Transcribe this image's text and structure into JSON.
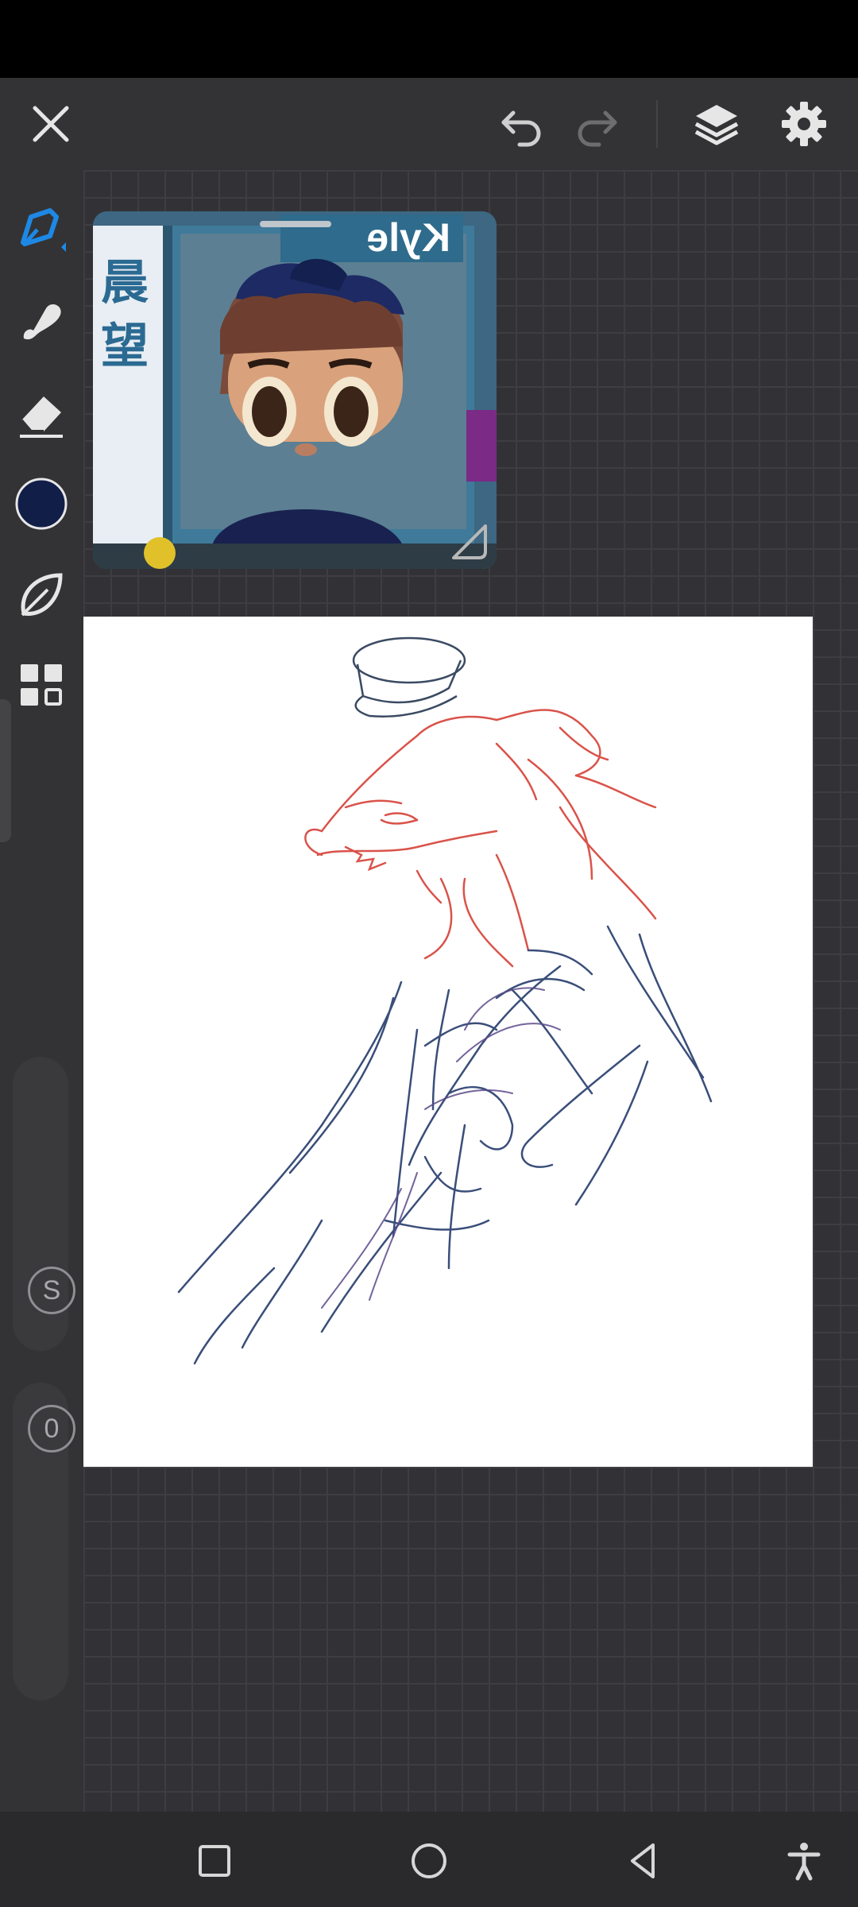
{
  "app": {
    "accent_color": "#1e88e5",
    "icon_color": "#e6e6e6",
    "current_brush_color": "#101e48"
  },
  "top_toolbar": {
    "close_icon": "close-icon",
    "undo_icon": "undo-icon",
    "redo_icon": "redo-icon",
    "layers_icon": "layers-icon",
    "settings_icon": "gear-icon"
  },
  "left_toolbar": {
    "tools": [
      "brush-icon",
      "smudge-icon",
      "eraser-icon",
      "color-swatch",
      "leaf-brush-icon",
      "grid-menu-icon"
    ],
    "size_slider_label": "S",
    "opacity_slider_label": "0"
  },
  "reference_window": {
    "name_tag_text": "Kyle",
    "side_text": "晨 望"
  },
  "nav_bar": {
    "icons": [
      "recents-icon",
      "home-icon",
      "back-icon",
      "accessibility-icon"
    ]
  }
}
